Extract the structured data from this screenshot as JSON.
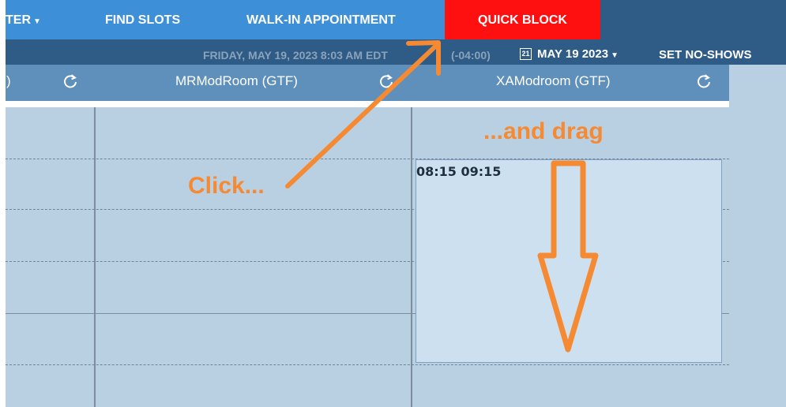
{
  "nav": {
    "filter_label": "TER",
    "find_slots": "FIND SLOTS",
    "walk_in": "WALK-IN APPOINTMENT",
    "quick_block": "QUICK BLOCK"
  },
  "subbar": {
    "current_datetime": "FRIDAY, MAY 19, 2023 8:03 AM EDT",
    "timezone_offset": "(-04:00)",
    "calendar_icon_day": "21",
    "selected_date": "MAY 19 2023",
    "set_no_shows": "SET NO-SHOWS"
  },
  "columns": [
    {
      "label": ")"
    },
    {
      "label": "MRModRoom (GTF)"
    },
    {
      "label": "XAModroom (GTF)"
    }
  ],
  "appointment": {
    "time_range": "08:15 09:15"
  },
  "annotations": {
    "click": "Click...",
    "drag": "...and drag",
    "color": "#f68a32"
  },
  "colors": {
    "nav_blue": "#3d8fd8",
    "quick_block_red": "#ff1010",
    "header_dark": "#2f5c86",
    "column_header": "#5f90bb",
    "grid_bg": "#b9d0e3"
  }
}
